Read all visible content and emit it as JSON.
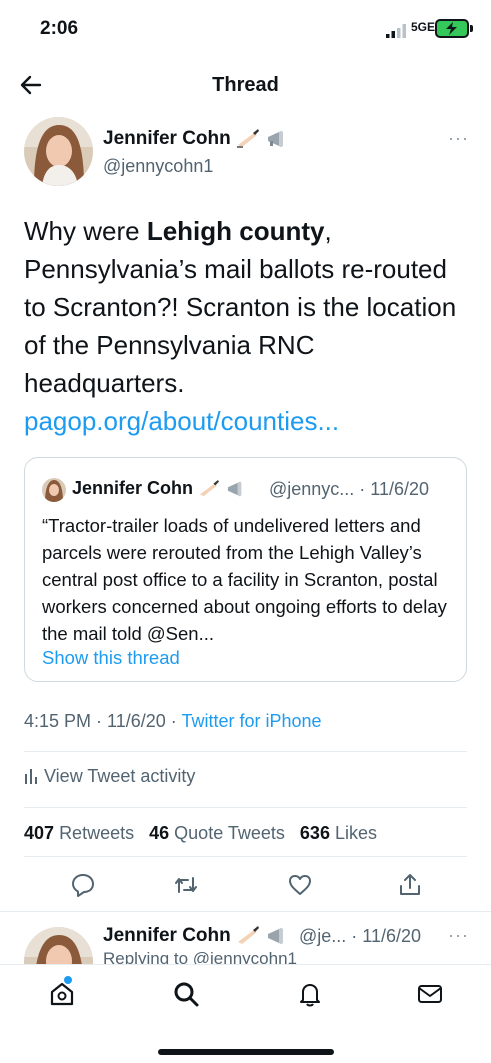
{
  "status_bar": {
    "time": "2:06",
    "network": "5GE"
  },
  "header": {
    "title": "Thread"
  },
  "tweet": {
    "author_name": "Jennifer Cohn",
    "author_handle": "@jennycohn1",
    "text_part1": "Why were ",
    "text_bold": "Lehigh county",
    "text_part2": ", Pennsylvania’s mail ballots re-routed to Scranton?! Scranton is the location of the Pennsylvania RNC headquarters. ",
    "text_link": "pagop.org/about/counties...",
    "time": "4:15 PM · 11/6/20",
    "dot": "·",
    "source": "Twitter for iPhone",
    "activity_label": "View Tweet activity",
    "retweets_count": "407",
    "retweets_label": "Retweets",
    "quote_count": "46",
    "quote_label": "Quote Tweets",
    "likes_count": "636",
    "likes_label": "Likes"
  },
  "quoted": {
    "author_name": "Jennifer Cohn",
    "meta": "@jennyc... · 11/6/20",
    "text": "“Tractor-trailer loads of undelivered letters and parcels were rerouted from the Lehigh Valley’s central post office to a facility in Scranton, postal workers concerned about ongoing efforts to delay the mail told @Sen...",
    "show_thread": "Show this thread"
  },
  "reply": {
    "author_name": "Jennifer Cohn",
    "meta": "@je... · 11/6/20",
    "subtext": "Replying to @jennycohn1"
  },
  "icons": {
    "back": "arrow-left-icon",
    "more": "more-icon",
    "reply": "reply-icon",
    "retweet": "retweet-icon",
    "like": "heart-icon",
    "share": "share-icon",
    "stats": "bar-chart-icon",
    "home": "home-icon",
    "search": "search-icon",
    "notifications": "bell-icon",
    "messages": "mail-icon"
  },
  "colors": {
    "link": "#1d9bf0",
    "secondary_text": "#536471",
    "battery": "#34c759"
  }
}
